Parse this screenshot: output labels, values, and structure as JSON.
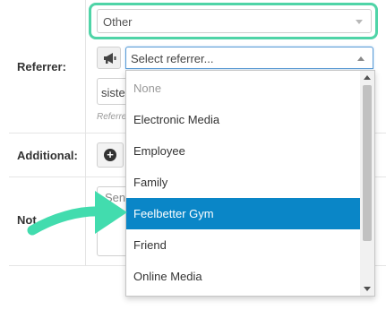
{
  "top_select": {
    "value": "Other"
  },
  "referrer": {
    "label": "Referrer:",
    "placeholder": "Select referrer...",
    "partial_value": "siste",
    "hint": "Referre"
  },
  "additional": {
    "label": "Additional:",
    "add_symbol": "+"
  },
  "notes": {
    "label": "Not",
    "partial_text": "Sen"
  },
  "dropdown": {
    "options": [
      {
        "label": "None",
        "state": "muted"
      },
      {
        "label": "Electronic Media",
        "state": "normal"
      },
      {
        "label": "Employee",
        "state": "normal"
      },
      {
        "label": "Family",
        "state": "normal"
      },
      {
        "label": "Feelbetter Gym",
        "state": "active"
      },
      {
        "label": "Friend",
        "state": "normal"
      },
      {
        "label": "Online Media",
        "state": "normal"
      }
    ]
  },
  "colors": {
    "highlight_ring": "#4fd4a7",
    "selected_option": "#0a86c7",
    "pointer_arrow": "#42dcae"
  },
  "icons": {
    "referrer_type": "megaphone-icon",
    "add": "plus-circle-icon",
    "pointer": "curved-arrow-icon"
  }
}
